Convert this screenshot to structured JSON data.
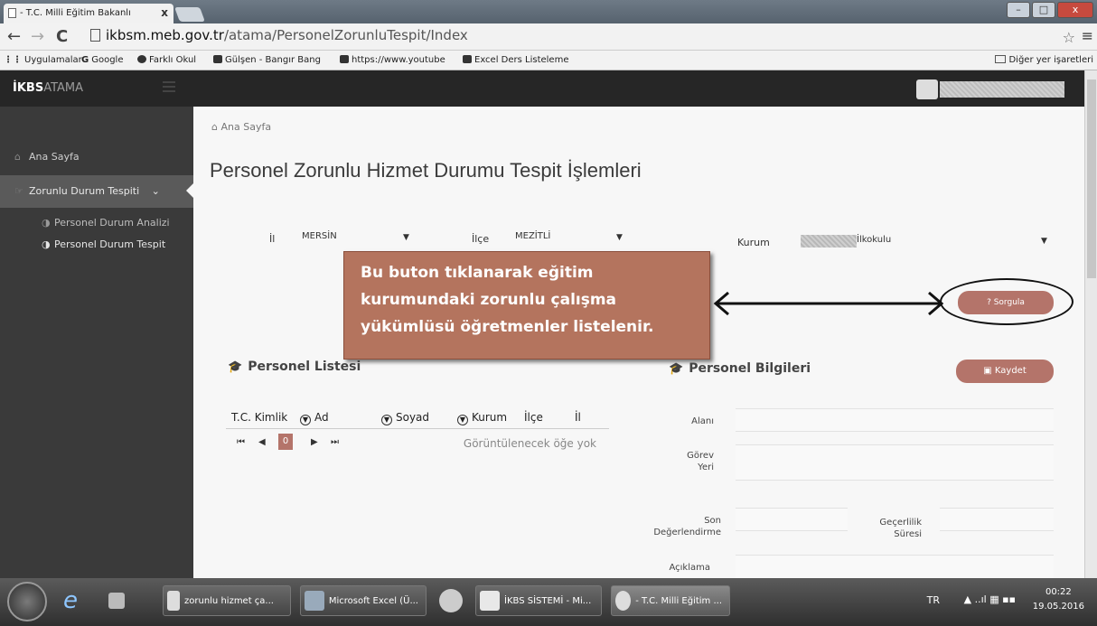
{
  "browser": {
    "tab_title": "- T.C. Milli Eğitim Bakanlı",
    "tab_close": "x",
    "url_host": "ikbsm.meb.gov.tr",
    "url_path": "/atama/PersonelZorunluTespit/Index",
    "window_controls": [
      "–",
      "□",
      "x"
    ],
    "bookmarks": [
      "Uygulamalar",
      "Google",
      "Farklı Okul",
      "Gülşen - Bangır Bang",
      "https://www.youtube",
      "Excel Ders Listeleme"
    ],
    "other_bookmarks": "Diğer yer işaretleri"
  },
  "app": {
    "brand_bold": "İKBS",
    "brand_thin": "ATAMA",
    "sidebar": {
      "items": [
        {
          "label": "Ana Sayfa",
          "icon": "home-icon"
        },
        {
          "label": "Zorunlu Durum Tespiti",
          "icon": "hand-pointer-icon"
        }
      ],
      "subitems": [
        {
          "label": "Personel Durum Analizi"
        },
        {
          "label": "Personel Durum Tespit"
        }
      ]
    },
    "breadcrumb": "Ana Sayfa",
    "page_title": "Personel Zorunlu Hizmet Durumu Tespit İşlemleri",
    "filters": {
      "il_label": "İl",
      "il_value": "MERSİN",
      "ilce_label": "İlçe",
      "ilce_value": "MEZİTLİ",
      "kurum_label": "Kurum",
      "kurum_value": "İlkokulu"
    },
    "callout_lines": [
      "Bu buton tıklanarak eğitim",
      "kurumundaki zorunlu çalışma",
      "yükümlüsü öğretmenler listelenir."
    ],
    "sorgula_label": "? Sorgula",
    "personel_listesi_title": "Personel Listesi",
    "personel_bilgileri_title": "Personel Bilgileri",
    "kaydet_label": "Kaydet",
    "grid_columns": [
      "T.C. Kimlik",
      "Ad",
      "Soyad",
      "Kurum",
      "İlçe",
      "İl"
    ],
    "pager_current": "0",
    "pager_empty": "Görüntülenecek öğe yok",
    "form": {
      "alani": "Alanı",
      "gorev_yeri_1": "Görev",
      "gorev_yeri_2": "Yeri",
      "son_deg_1": "Son",
      "son_deg_2": "Değerlendirme",
      "gecerlilik_1": "Geçerlilik",
      "gecerlilik_2": "Süresi",
      "aciklama": "Açıklama"
    }
  },
  "taskbar": {
    "tasks": [
      "zorunlu hizmet ça...",
      "Microsoft Excel (Ü...",
      "İKBS SİSTEMİ - Mi...",
      "- T.C. Milli Eğitim ..."
    ],
    "lang": "TR",
    "time": "00:22",
    "date": "19.05.2016"
  }
}
